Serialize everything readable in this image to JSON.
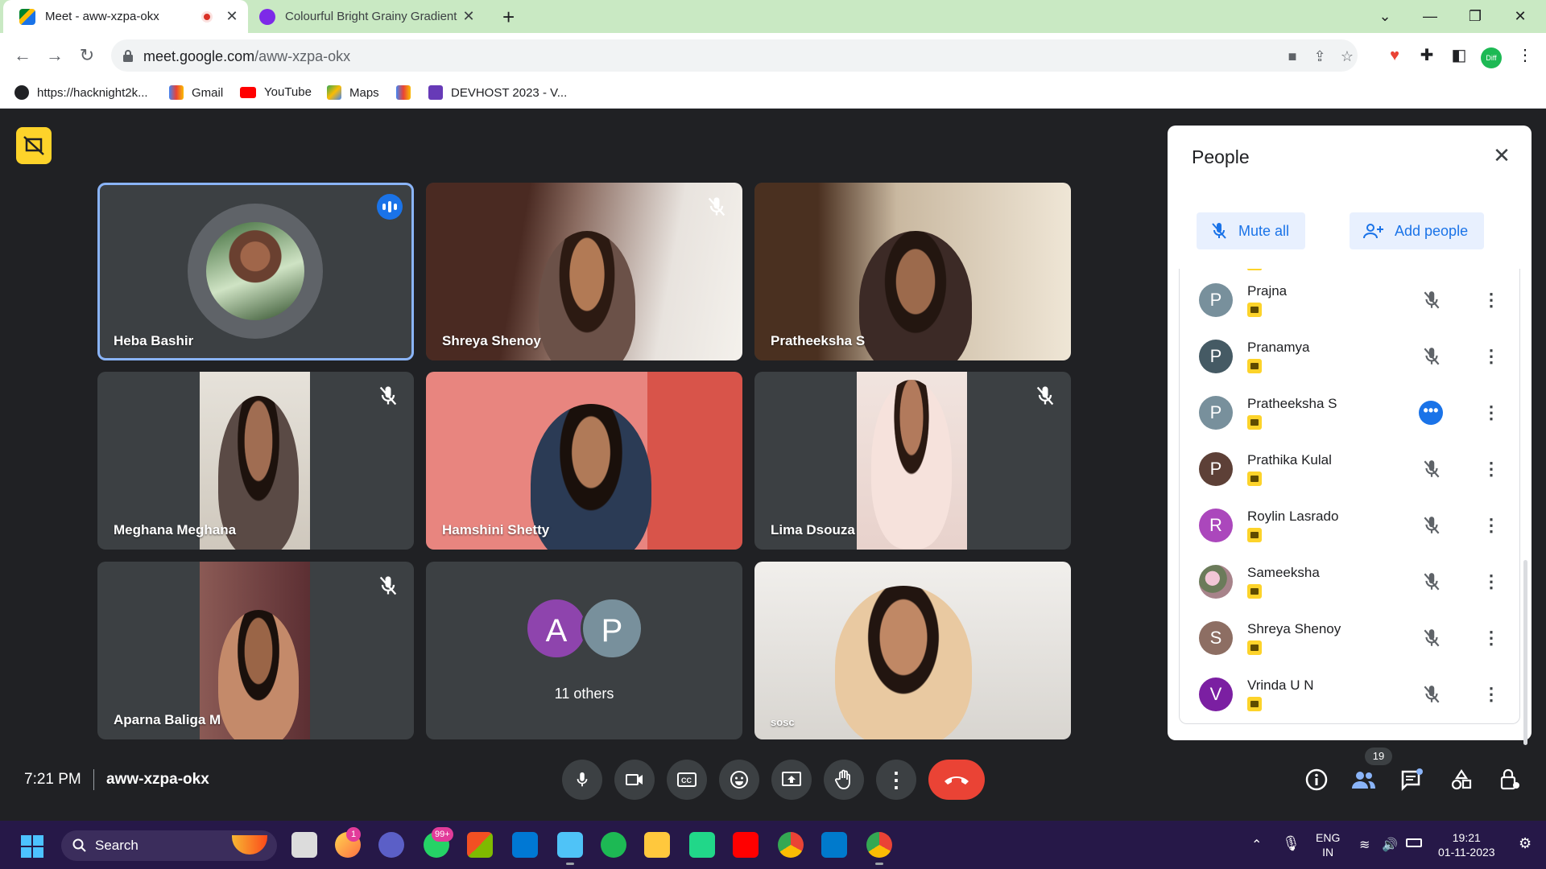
{
  "browser": {
    "tabs": [
      {
        "title": "Meet - aww-xzpa-okx",
        "active": true
      },
      {
        "title": "Colourful Bright Grainy Gradient",
        "active": false
      }
    ],
    "url_host": "meet.google.com",
    "url_path": "/aww-xzpa-okx",
    "bookmarks": [
      {
        "label": "https://hacknight2k..."
      },
      {
        "label": "Gmail"
      },
      {
        "label": "YouTube"
      },
      {
        "label": "Maps"
      },
      {
        "label": ""
      },
      {
        "label": "DEVHOST 2023 - V..."
      }
    ],
    "profile_badge": "Diff"
  },
  "tiles": [
    {
      "name": "Heba Bashir"
    },
    {
      "name": "Shreya Shenoy"
    },
    {
      "name": "Pratheeksha S"
    },
    {
      "name": "Meghana Meghana"
    },
    {
      "name": "Hamshini Shetty"
    },
    {
      "name": "Lima Dsouza"
    },
    {
      "name": "Aparna Baliga M"
    },
    {
      "name": "11 others",
      "avatars": [
        "A",
        "P"
      ]
    },
    {
      "name": "sosc"
    }
  ],
  "panel": {
    "title": "People",
    "mute_all": "Mute all",
    "add_people": "Add people",
    "participants": [
      {
        "initial": "P",
        "name": "Prajna",
        "color": "#78909c"
      },
      {
        "initial": "P",
        "name": "Pranamya",
        "color": "#455a64"
      },
      {
        "initial": "P",
        "name": "Pratheeksha S",
        "color": "#78909c"
      },
      {
        "initial": "P",
        "name": "Prathika Kulal",
        "color": "#5d4037"
      },
      {
        "initial": "R",
        "name": "Roylin Lasrado",
        "color": "#ab47bc"
      },
      {
        "initial": "",
        "name": "Sameeksha",
        "color": "#8d6e63"
      },
      {
        "initial": "S",
        "name": "Shreya Shenoy",
        "color": "#8d6e63"
      },
      {
        "initial": "V",
        "name": "Vrinda U N",
        "color": "#7b1fa2"
      }
    ]
  },
  "controls": {
    "time": "7:21 PM",
    "meeting_code": "aww-xzpa-okx",
    "people_count": "19"
  },
  "taskbar": {
    "search": "Search",
    "badges": {
      "photos": "1",
      "whatsapp": "99+"
    },
    "lang_top": "ENG",
    "lang_bottom": "IN",
    "time": "19:21",
    "date": "01-11-2023"
  }
}
